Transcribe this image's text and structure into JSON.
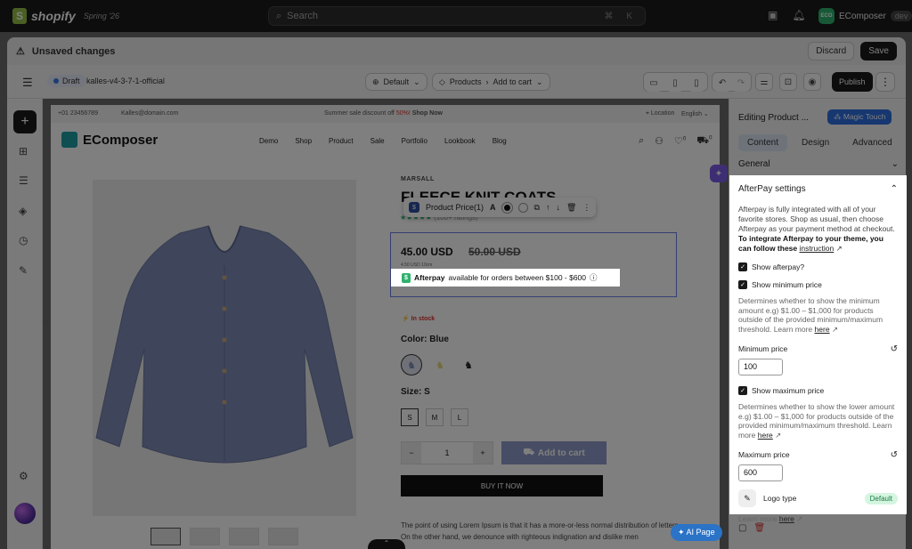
{
  "topbar": {
    "brand": "shopify",
    "edition": "Spring '26",
    "search_placeholder": "Search",
    "shortcut": "⌘ K",
    "store_initials": "ECO",
    "store_name": "EComposer",
    "env_badge": "dev"
  },
  "unsaved": {
    "message": "Unsaved changes",
    "discard": "Discard",
    "save": "Save"
  },
  "toolbar": {
    "status": "Draft",
    "theme": "kalles-v4-3-7-1-official",
    "template": "Default",
    "breadcrumb_page": "Products",
    "breadcrumb_section": "Add to cart",
    "publish": "Publish"
  },
  "canvas": {
    "phone": "+01 23456789",
    "email": "Kalles@domain.com",
    "promo_prefix": "Summer sale discount off ",
    "promo_percent": "50%!",
    "promo_link": "Shop Now",
    "location": "Location",
    "language": "English",
    "brand": "EComposer",
    "menu": [
      "Demo",
      "Shop",
      "Product",
      "Sale",
      "Portfolio",
      "Lookbook",
      "Blog"
    ],
    "cart_count": "0",
    "wishlist_count": "0",
    "vendor": "MARSALL",
    "title": "FLEECE KNIT COATS",
    "rating_stars": "★★★★★",
    "rating_text": "(100+ ratings)",
    "price": "45.00 USD",
    "old_price": "50.00 USD",
    "installment": "4.50 USD 10cm",
    "afterpay_brand": "Afterpay",
    "afterpay_text": "available for orders between $100 - $600",
    "stock": "In stock",
    "color_label": "Color:",
    "color_value": "Blue",
    "size_label": "Size:",
    "size_value": "S",
    "sizes": [
      "S",
      "M",
      "L"
    ],
    "qty": "1",
    "add_to_cart": "Add to cart",
    "buy_now": "BUY IT NOW",
    "description": "The point of using Lorem Ipsum is that it has a more-or-less normal distribution of letters. On the other hand, we denounce with righteous indignation and dislike men",
    "ai_page": "AI Page"
  },
  "element_toolbar": {
    "label": "Product Price(1)"
  },
  "panel": {
    "title": "Editing Product ...",
    "magic": "Magic Touch",
    "tabs": [
      "Content",
      "Design",
      "Advanced"
    ],
    "general": "General",
    "afterpay_header": "AfterPay settings",
    "intro": "Afterpay is fully integrated with all of your favorite stores. Shop as usual, then choose Afterpay as your payment method at checkout.",
    "intro_bold": "To integrate Afterpay to your theme, you can follow these",
    "intro_link": "instruction",
    "show_afterpay": "Show afterpay?",
    "show_min": "Show minimum price",
    "min_help": "Determines whether to show the minimum amount e.g) $1.00 – $1,000 for products outside of the provided minimum/maximum threshold. Learn more",
    "here": "here",
    "min_label": "Minimum price",
    "min_value": "100",
    "show_max": "Show maximum price",
    "max_help": "Determines whether to show the lower amount e.g) $1.00 – $1,000 for products outside of the provided minimum/maximum threshold. Learn more",
    "max_label": "Maximum price",
    "max_value": "600",
    "logo_type": "Logo type",
    "logo_default": "Default",
    "learn_more": "Learn more"
  }
}
